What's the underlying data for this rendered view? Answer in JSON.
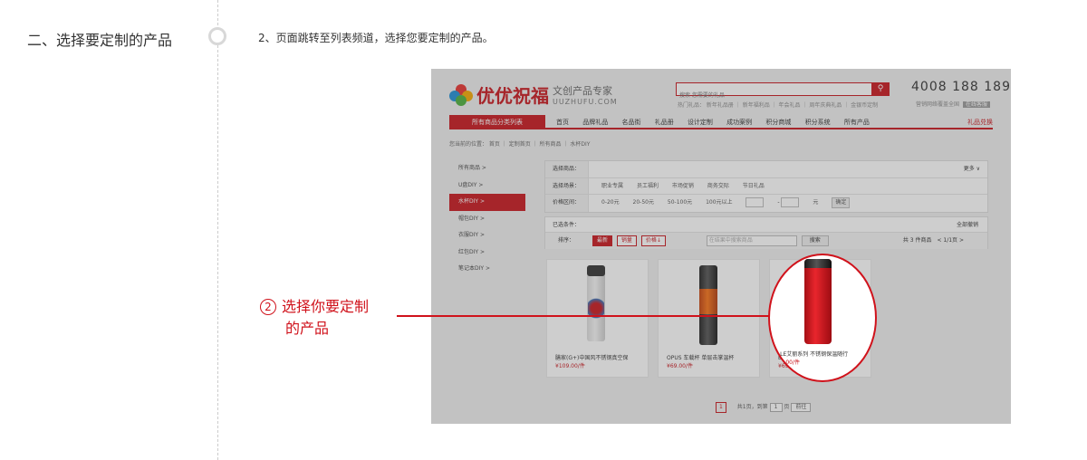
{
  "step": {
    "title": "二、选择要定制的产品",
    "desc": "2、页面跳转至列表频道，选择您要定制的产品。"
  },
  "site": {
    "brand": "优优祝福",
    "brand_sub": "文创产品专家",
    "brand_url": "UUZHUFU.COM",
    "search_placeholder": "搜索 您需要的礼品",
    "hotwords": "热门礼品： 新年礼品册 ｜ 新年福利品 ｜ 年会礼品 ｜ 周年庆典礼品 ｜ 金银币定制",
    "phone": "4008 188 189",
    "phone_sub": "营销网络覆盖全国",
    "phone_tag": "在线客服",
    "nav_category": "所有商品分类列表",
    "nav_items": [
      "首页",
      "品牌礼品",
      "名品街",
      "礼品册",
      "设计定制",
      "成功案例",
      "积分商城",
      "积分系统",
      "所有产品"
    ],
    "nav_right": "礼品兑换",
    "breadcrumb": "您当前的位置： 首页 ｜ 定制首页 ｜ 所有商品 ｜ 水杯DIY",
    "sidebar": [
      "所有商品 >",
      "U盘DIY >",
      "水杯DIY >",
      "帽包DIY >",
      "衣服DIY >",
      "红包DIY >",
      "笔记本DIY >"
    ],
    "filter": {
      "row1_label": "选择商品：",
      "more": "更多 ∨",
      "row2_label": "选择场景：",
      "row2_opts": [
        "职业专属",
        "员工福利",
        "市场促销",
        "商务交际",
        "节日礼品"
      ],
      "row3_label": "价格区间：",
      "row3_opts": [
        "0-20元",
        "20-50元",
        "50-100元",
        "100元以上"
      ],
      "row3_unit": "元",
      "row3_ok": "确定"
    },
    "chosen": {
      "label": "已选条件：",
      "clear": "全部撤销",
      "sort_label": "排序：",
      "sort_opts": [
        "最新",
        "销量",
        "价格↓"
      ],
      "keyword_placeholder": "在结果中搜索商品",
      "search_btn": "搜索",
      "count": "共 3 件商品　< 1/1页 >"
    },
    "products": [
      {
        "name": "膳家(G+)中国风不锈钢真空保",
        "price": "¥109.00/件"
      },
      {
        "name": "OPUS 车载杯 单层击掌温杯",
        "price": "¥69.00/件"
      },
      {
        "name": "ELLE艾丽系列 不锈钢保温随行",
        "price": "¥69.00/件"
      }
    ],
    "pager": {
      "current": "1",
      "text": "共1页，到第",
      "page_box": "1",
      "unit": "页",
      "go": "前往"
    }
  },
  "callout": {
    "num": "2",
    "line1": "选择你要定制",
    "line2": "的产品"
  },
  "colors": {
    "accent": "#c8161d",
    "callout": "#d0121b"
  }
}
